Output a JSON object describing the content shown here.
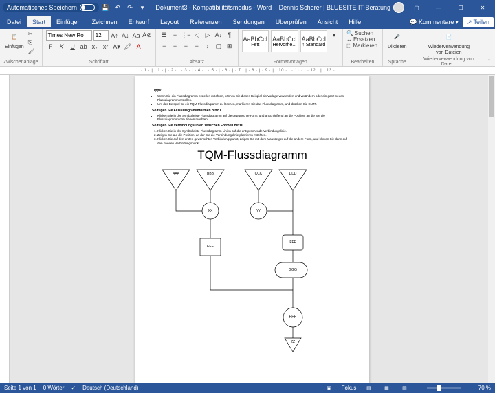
{
  "titlebar": {
    "autosave": "Automatisches Speichern",
    "doc": "Dokument3  -  Kompatibilitätsmodus  -  Word",
    "user": "Dennis Scherer | BLUESITE IT-Beratung"
  },
  "menu": {
    "file": "Datei",
    "home": "Start",
    "insert": "Einfügen",
    "draw": "Zeichnen",
    "design": "Entwurf",
    "layout": "Layout",
    "ref": "Referenzen",
    "mail": "Sendungen",
    "review": "Überprüfen",
    "view": "Ansicht",
    "help": "Hilfe",
    "comments": "Kommentare",
    "share": "Teilen"
  },
  "ribbon": {
    "clipboard": {
      "label": "Zwischenablage",
      "paste": "Einfügen"
    },
    "font": {
      "label": "Schriftart",
      "name": "Times New Ro",
      "size": "12"
    },
    "paragraph": {
      "label": "Absatz"
    },
    "styles": {
      "label": "Formatvorlagen",
      "preview": "AaBbCcI",
      "s1": "Fett",
      "s2": "Hervorhe...",
      "s3": "↑ Standard"
    },
    "editing": {
      "label": "Bearbeiten",
      "find": "Suchen",
      "replace": "Ersetzen",
      "select": "Markieren"
    },
    "voice": {
      "label": "Sprache",
      "dictate": "Diktieren"
    },
    "reuse": {
      "label": "Wiederverwendung von Datei...",
      "btn": "Wiederverwendung\nvon Dateien"
    }
  },
  "doc": {
    "tipsTitle": "Tipps:",
    "tip1": "Wenn Sie ein Flussdiagramm erstellen möchten, können Sie dieses Beispiel als Vorlage verwenden und verändern oder ein ganz neues Flussdiagramm erstellen.",
    "tip2": "Um das Beispiel für ein TQM-Flussdiagramm zu löschen, markieren Sie das Flussdiagramm, und drücken Sie ENTF.",
    "sub1": "So fügen Sie Flussdiagrammformen hinzu",
    "sub1tip": "Klicken Sie in der Symbolleiste Flussdiagramm auf die gewünschte Form, und anschließend an die Position, an die Sie die Flussdiagrammform ziehen möchten.",
    "sub2": "So fügen Sie Verbindungslinien zwischen Formen hinzu",
    "sub2t1": "Klicken Sie in der Symbolleiste Flussdiagramm Linien auf die entsprechende Verbindungslinie.",
    "sub2t2": "Zeigen Sie auf die Position, an der Sie die Verbindungslinie platzieren möchten.",
    "sub2t3": "Klicken Sie auf den ersten gewünschten Verbindungspunkt, zeigen Sie mit dem Mauszeiger auf die andere Form, und klicken Sie dann auf den zweiten Verbindungspunkt.",
    "title": "TQM-Flussdiagramm",
    "shapes": {
      "aaa": "AAA",
      "bbb": "BBB",
      "ccc": "CCC",
      "ddd": "DDD",
      "xx": "XX",
      "yy": "YY",
      "eee": "EEE",
      "fff": "FFF",
      "ggg": "GGG",
      "hhh": "HHH",
      "zz": "ZZ"
    }
  },
  "status": {
    "page": "Seite 1 von 1",
    "words": "0 Wörter",
    "lang": "Deutsch (Deutschland)",
    "focus": "Fokus",
    "zoom": "70 %"
  }
}
